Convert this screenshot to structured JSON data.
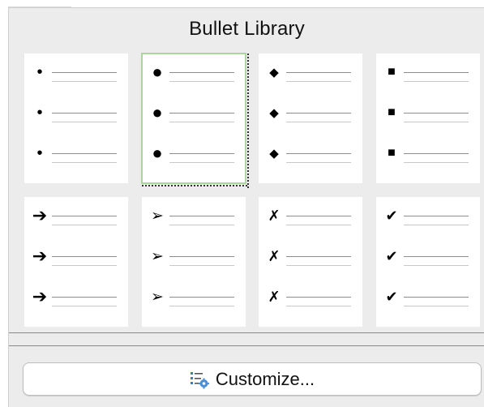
{
  "title": "Bullet Library",
  "customize_button": {
    "label": "Customize...",
    "icon": "bullets-settings-icon"
  },
  "bullet_styles": [
    {
      "name": "small-dot",
      "glyph": "•",
      "size": "20px",
      "selected": false
    },
    {
      "name": "large-dot",
      "glyph": "●",
      "size": "22px",
      "selected": true
    },
    {
      "name": "diamond",
      "glyph": "◆",
      "size": "15px",
      "selected": false
    },
    {
      "name": "square",
      "glyph": "■",
      "size": "16px",
      "selected": false
    },
    {
      "name": "arrow",
      "glyph": "➔",
      "size": "22px",
      "selected": false
    },
    {
      "name": "arrowhead",
      "glyph": "➢",
      "size": "19px",
      "selected": false
    },
    {
      "name": "cross-mark",
      "glyph": "✗",
      "size": "18px",
      "selected": false
    },
    {
      "name": "check-mark",
      "glyph": "✔",
      "size": "18px",
      "selected": false
    }
  ],
  "colors": {
    "panel_background": "#ececec",
    "cell_background": "#ffffff",
    "selection_outline": "#a8d898"
  }
}
